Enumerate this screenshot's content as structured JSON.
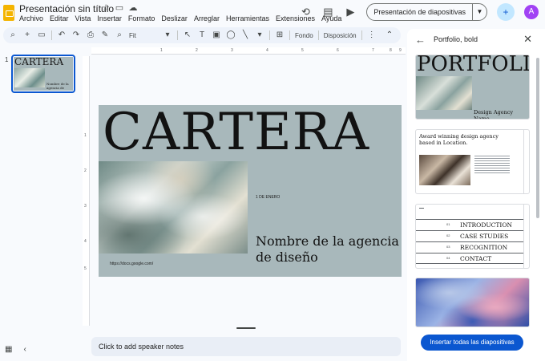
{
  "header": {
    "doc_title": "Presentación sin título",
    "menu": [
      "Archivo",
      "Editar",
      "Vista",
      "Insertar",
      "Formato",
      "Deslizar",
      "Arreglar",
      "Herramientas",
      "Extensiones",
      "Ayuda"
    ],
    "present_label": "Presentación de diapositivas",
    "avatar_letter": "A"
  },
  "toolbar": {
    "zoom": "Fit",
    "background_label": "Fondo",
    "layout_label": "Disposición"
  },
  "filmstrip": {
    "slide_number": "1",
    "thumb_title": "CARTERA",
    "thumb_subtitle": "Nombre de la agencia de diseño"
  },
  "ruler": {
    "top_numbers": [
      "1",
      "2",
      "3",
      "4",
      "5",
      "6",
      "7",
      "8",
      "9"
    ],
    "left_numbers": [
      "1",
      "2",
      "3",
      "4",
      "5"
    ]
  },
  "slide": {
    "title": "CARTERA",
    "date": "1 DE ENERO",
    "agency_name": "Nombre de la agencia de diseño",
    "url": "https://docs.google.com/"
  },
  "notes": {
    "placeholder": "Click to add speaker notes"
  },
  "panel": {
    "title": "Portfolio, bold",
    "thumb1_title": "PORTFOLIO",
    "thumb1_subtitle": "Design Agency Name",
    "thumb2_title": "Award winning design agency based in Location.",
    "thumb3_items": [
      {
        "num": "01",
        "label": "INTRODUCTION"
      },
      {
        "num": "02",
        "label": "CASE STUDIES"
      },
      {
        "num": "03",
        "label": "RECOGNITION"
      },
      {
        "num": "04",
        "label": "CONTACT"
      }
    ],
    "insert_all_label": "Insertar todas las diapositivas"
  },
  "colors": {
    "slide_bg": "#a8b8bb",
    "accent": "#0b57d0",
    "selection_border": "#0b57d0",
    "avatar": "#a142f4"
  }
}
